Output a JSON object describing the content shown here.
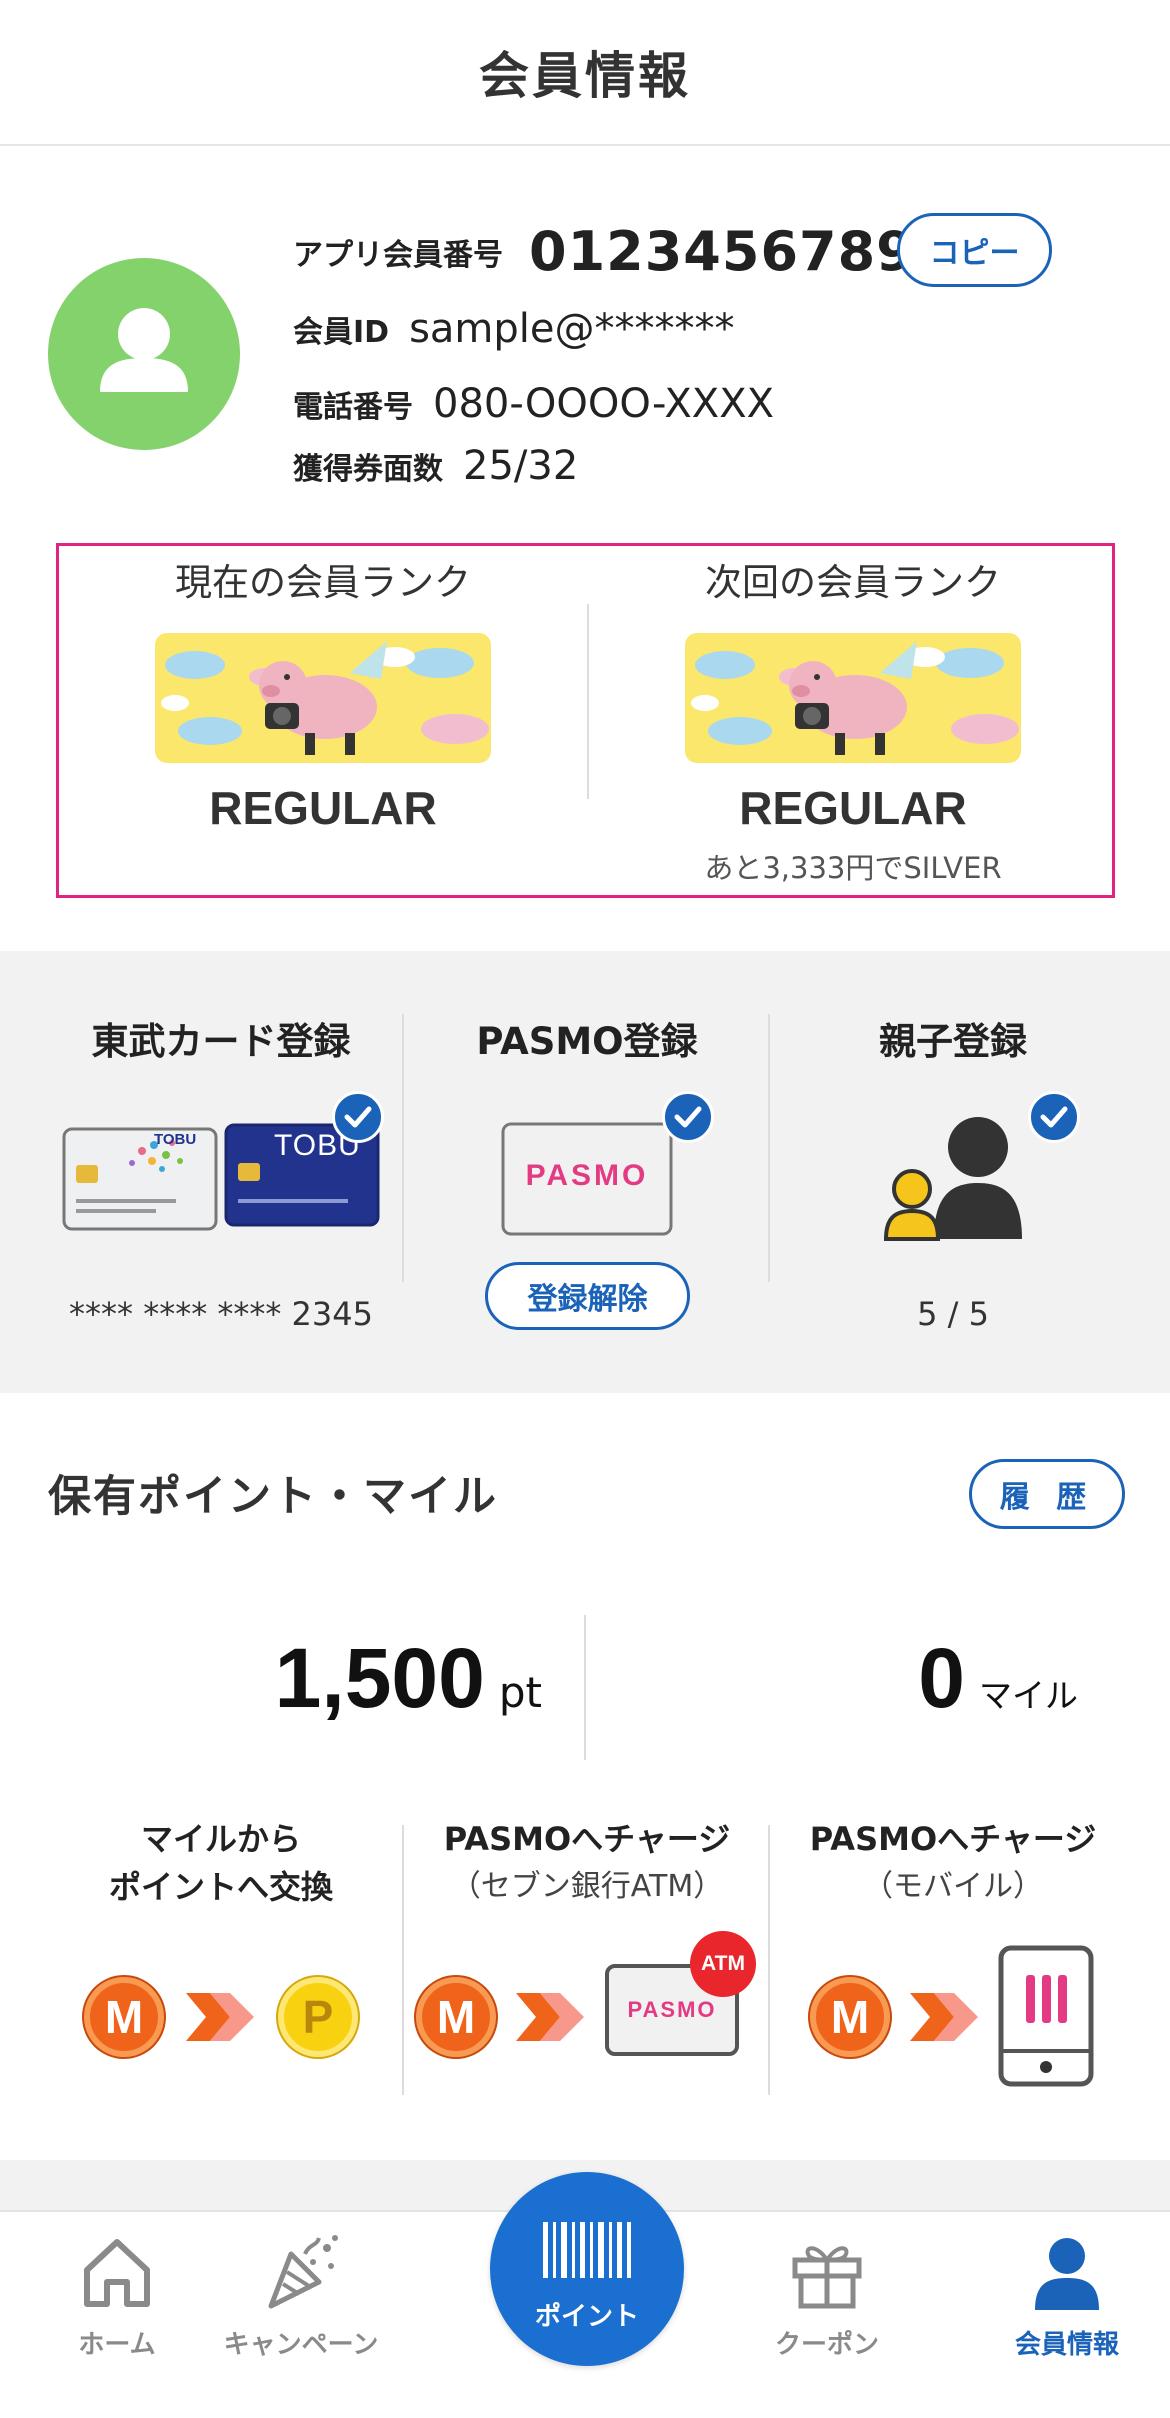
{
  "header": {
    "title": "会員情報"
  },
  "profile": {
    "app_member_number_label": "アプリ会員番号",
    "app_member_number": "0123456789",
    "copy_button": "コピー",
    "member_id_label": "会員ID",
    "member_id": "sample@*******",
    "phone_label": "電話番号",
    "phone": "080-OOOO-XXXX",
    "tickets_label": "獲得券面数",
    "tickets": "25/32"
  },
  "rank": {
    "current_title": "現在の会員ランク",
    "current_rank": "REGULAR",
    "next_title": "次回の会員ランク",
    "next_rank": "REGULAR",
    "next_note": "あと3,333円でSILVER"
  },
  "registration": {
    "tobu_card": {
      "title": "東武カード登録",
      "card_number": "**** **** **** 2345",
      "card_logo": "TOBU"
    },
    "pasmo": {
      "title": "PASMO登録",
      "card_logo": "PASMO",
      "unregister_button": "登録解除"
    },
    "family": {
      "title": "親子登録",
      "count": "5 / 5"
    }
  },
  "points": {
    "section_title": "保有ポイント・マイル",
    "history_button": "履 歴",
    "points_value": "1,500",
    "points_unit": "pt",
    "miles_value": "0",
    "miles_unit": "マイル"
  },
  "actions": [
    {
      "line1": "マイルから",
      "line2": "ポイントへ交換",
      "from_coin": "M",
      "to_coin": "P"
    },
    {
      "line1": "PASMOへチャージ",
      "line2": "（セブン銀行ATM）",
      "from_coin": "M",
      "badge": "ATM",
      "card_logo": "PASMO"
    },
    {
      "line1": "PASMOへチャージ",
      "line2": "（モバイル）",
      "from_coin": "M"
    }
  ],
  "tabbar": {
    "items": [
      {
        "label": "ホーム",
        "icon": "home-icon"
      },
      {
        "label": "キャンペーン",
        "icon": "party-popper-icon"
      },
      {
        "label": "ポイント",
        "icon": "barcode-icon"
      },
      {
        "label": "クーポン",
        "icon": "gift-icon"
      },
      {
        "label": "会員情報",
        "icon": "person-icon",
        "active": true
      }
    ]
  },
  "colors": {
    "accent": "#1a63b8",
    "highlight_border": "#e3237f",
    "avatar": "#84d26b",
    "mile_coin": "#f0631b",
    "point_coin": "#f8d210"
  }
}
